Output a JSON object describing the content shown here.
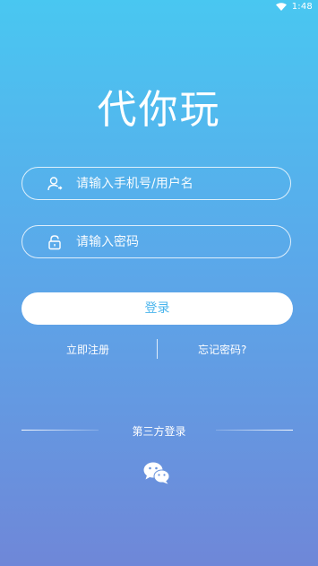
{
  "status_bar": {
    "time": "1:48"
  },
  "app": {
    "title": "代你玩"
  },
  "login_form": {
    "username_placeholder": "请输入手机号/用户名",
    "password_placeholder": "请输入密码",
    "login_label": "登录"
  },
  "links": {
    "register": "立即注册",
    "forgot": "忘记密码?"
  },
  "third_party": {
    "label": "第三方登录",
    "providers": [
      "wechat"
    ]
  },
  "colors": {
    "accent": "#49b4ec",
    "gradient_top": "#49c7f1",
    "gradient_bottom": "#6f87d8"
  }
}
